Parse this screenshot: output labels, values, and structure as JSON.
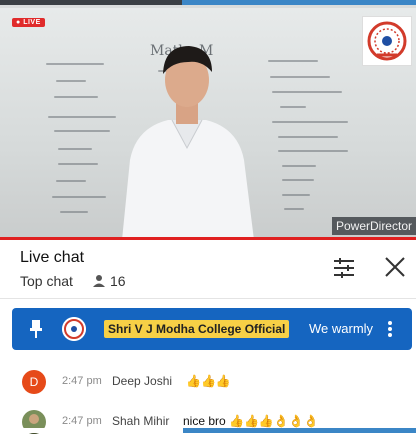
{
  "video": {
    "live_label": "LIVE",
    "watermark": "PowerDirector",
    "board_title": "Maths M"
  },
  "chat": {
    "title": "Live chat",
    "mode": "Top chat",
    "viewer_count": "16",
    "colors": {
      "pinned_bg": "#1565c0",
      "author_chip": "#f7d046",
      "live_red": "#e02020"
    }
  },
  "pinned": {
    "author": "Shri V J Modha College Official",
    "message": "We warmly"
  },
  "messages": [
    {
      "avatar_letter": "D",
      "time": "2:47 pm",
      "author": "Deep Joshi",
      "text": "👍👍👍"
    },
    {
      "avatar_letter": "",
      "time": "2:47 pm",
      "author": "Shah Mihir",
      "text": "nice bro 👍👍👍👌👌👌"
    }
  ]
}
